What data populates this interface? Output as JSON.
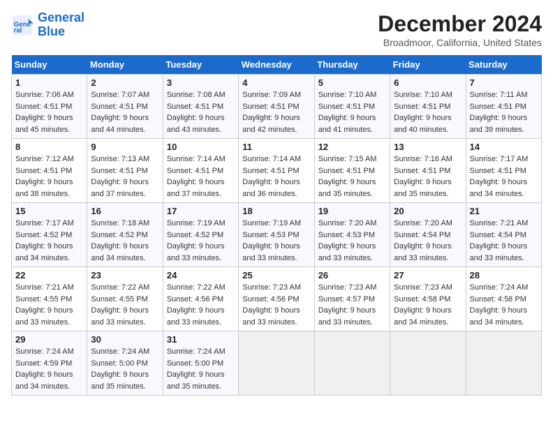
{
  "logo": {
    "line1": "General",
    "line2": "Blue"
  },
  "title": "December 2024",
  "subtitle": "Broadmoor, California, United States",
  "days_of_week": [
    "Sunday",
    "Monday",
    "Tuesday",
    "Wednesday",
    "Thursday",
    "Friday",
    "Saturday"
  ],
  "weeks": [
    [
      {
        "num": "1",
        "rise": "7:06 AM",
        "set": "4:51 PM",
        "daylight": "9 hours and 45 minutes."
      },
      {
        "num": "2",
        "rise": "7:07 AM",
        "set": "4:51 PM",
        "daylight": "9 hours and 44 minutes."
      },
      {
        "num": "3",
        "rise": "7:08 AM",
        "set": "4:51 PM",
        "daylight": "9 hours and 43 minutes."
      },
      {
        "num": "4",
        "rise": "7:09 AM",
        "set": "4:51 PM",
        "daylight": "9 hours and 42 minutes."
      },
      {
        "num": "5",
        "rise": "7:10 AM",
        "set": "4:51 PM",
        "daylight": "9 hours and 41 minutes."
      },
      {
        "num": "6",
        "rise": "7:10 AM",
        "set": "4:51 PM",
        "daylight": "9 hours and 40 minutes."
      },
      {
        "num": "7",
        "rise": "7:11 AM",
        "set": "4:51 PM",
        "daylight": "9 hours and 39 minutes."
      }
    ],
    [
      {
        "num": "8",
        "rise": "7:12 AM",
        "set": "4:51 PM",
        "daylight": "9 hours and 38 minutes."
      },
      {
        "num": "9",
        "rise": "7:13 AM",
        "set": "4:51 PM",
        "daylight": "9 hours and 37 minutes."
      },
      {
        "num": "10",
        "rise": "7:14 AM",
        "set": "4:51 PM",
        "daylight": "9 hours and 37 minutes."
      },
      {
        "num": "11",
        "rise": "7:14 AM",
        "set": "4:51 PM",
        "daylight": "9 hours and 36 minutes."
      },
      {
        "num": "12",
        "rise": "7:15 AM",
        "set": "4:51 PM",
        "daylight": "9 hours and 35 minutes."
      },
      {
        "num": "13",
        "rise": "7:16 AM",
        "set": "4:51 PM",
        "daylight": "9 hours and 35 minutes."
      },
      {
        "num": "14",
        "rise": "7:17 AM",
        "set": "4:51 PM",
        "daylight": "9 hours and 34 minutes."
      }
    ],
    [
      {
        "num": "15",
        "rise": "7:17 AM",
        "set": "4:52 PM",
        "daylight": "9 hours and 34 minutes."
      },
      {
        "num": "16",
        "rise": "7:18 AM",
        "set": "4:52 PM",
        "daylight": "9 hours and 34 minutes."
      },
      {
        "num": "17",
        "rise": "7:19 AM",
        "set": "4:52 PM",
        "daylight": "9 hours and 33 minutes."
      },
      {
        "num": "18",
        "rise": "7:19 AM",
        "set": "4:53 PM",
        "daylight": "9 hours and 33 minutes."
      },
      {
        "num": "19",
        "rise": "7:20 AM",
        "set": "4:53 PM",
        "daylight": "9 hours and 33 minutes."
      },
      {
        "num": "20",
        "rise": "7:20 AM",
        "set": "4:54 PM",
        "daylight": "9 hours and 33 minutes."
      },
      {
        "num": "21",
        "rise": "7:21 AM",
        "set": "4:54 PM",
        "daylight": "9 hours and 33 minutes."
      }
    ],
    [
      {
        "num": "22",
        "rise": "7:21 AM",
        "set": "4:55 PM",
        "daylight": "9 hours and 33 minutes."
      },
      {
        "num": "23",
        "rise": "7:22 AM",
        "set": "4:55 PM",
        "daylight": "9 hours and 33 minutes."
      },
      {
        "num": "24",
        "rise": "7:22 AM",
        "set": "4:56 PM",
        "daylight": "9 hours and 33 minutes."
      },
      {
        "num": "25",
        "rise": "7:23 AM",
        "set": "4:56 PM",
        "daylight": "9 hours and 33 minutes."
      },
      {
        "num": "26",
        "rise": "7:23 AM",
        "set": "4:57 PM",
        "daylight": "9 hours and 33 minutes."
      },
      {
        "num": "27",
        "rise": "7:23 AM",
        "set": "4:58 PM",
        "daylight": "9 hours and 34 minutes."
      },
      {
        "num": "28",
        "rise": "7:24 AM",
        "set": "4:58 PM",
        "daylight": "9 hours and 34 minutes."
      }
    ],
    [
      {
        "num": "29",
        "rise": "7:24 AM",
        "set": "4:59 PM",
        "daylight": "9 hours and 34 minutes."
      },
      {
        "num": "30",
        "rise": "7:24 AM",
        "set": "5:00 PM",
        "daylight": "9 hours and 35 minutes."
      },
      {
        "num": "31",
        "rise": "7:24 AM",
        "set": "5:00 PM",
        "daylight": "9 hours and 35 minutes."
      },
      null,
      null,
      null,
      null
    ]
  ]
}
